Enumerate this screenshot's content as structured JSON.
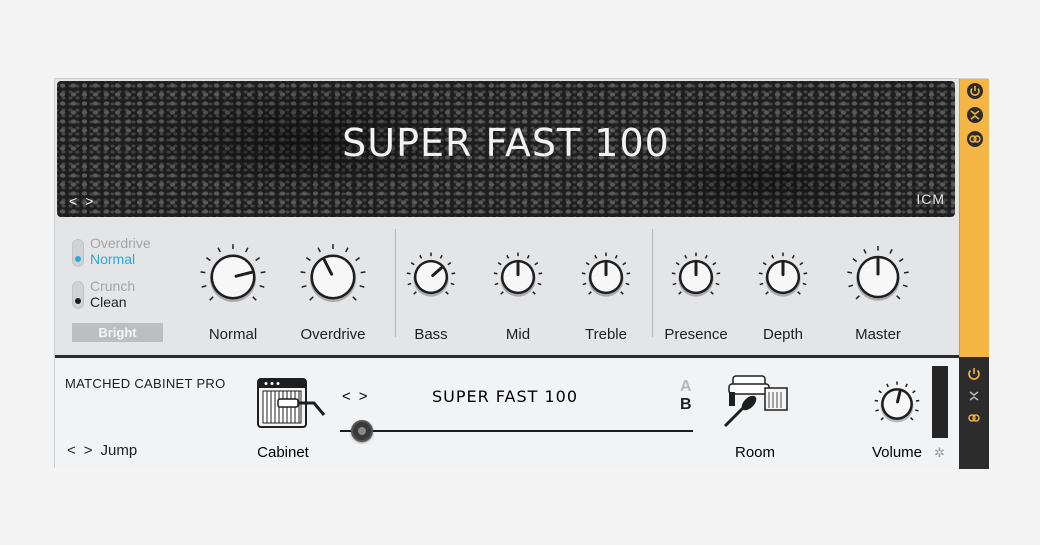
{
  "amp": {
    "title": "SUPER FAST 100",
    "brand": "ICM",
    "nav_prev": "<",
    "nav_next": ">"
  },
  "channels": {
    "top": {
      "option1": "Overdrive",
      "option2": "Normal",
      "selected": "Normal"
    },
    "bottom": {
      "option1": "Crunch",
      "option2": "Clean",
      "selected": "Clean"
    },
    "bright_label": "Bright"
  },
  "knobs": [
    {
      "label": "Normal",
      "value": 0.78
    },
    {
      "label": "Overdrive",
      "value": 0.4
    },
    {
      "label": "Bass",
      "value": 0.68
    },
    {
      "label": "Mid",
      "value": 0.5
    },
    {
      "label": "Treble",
      "value": 0.5
    },
    {
      "label": "Presence",
      "value": 0.5
    },
    {
      "label": "Depth",
      "value": 0.5
    },
    {
      "label": "Master",
      "value": 0.5
    }
  ],
  "cabinet": {
    "section_title": "MATCHED CABINET PRO",
    "nav_prev": "<",
    "nav_next": ">",
    "jump_label": "Jump",
    "cabinet_label": "Cabinet",
    "preset_prev": "<",
    "preset_next": ">",
    "preset_name": "SUPER FAST 100",
    "ab_a": "A",
    "ab_b": "B",
    "ab_selected": "B",
    "mic_position": 0.05,
    "room_label": "Room",
    "volume_label": "Volume",
    "volume_value": 0.55
  },
  "colors": {
    "accent": "#f5b545",
    "selected_blue": "#29a8e0",
    "strip_dark": "#2c2c2c"
  },
  "icons": {
    "power": "power-icon",
    "collapse": "collapse-icon",
    "link": "link-icon",
    "settings": "gear-icon"
  }
}
